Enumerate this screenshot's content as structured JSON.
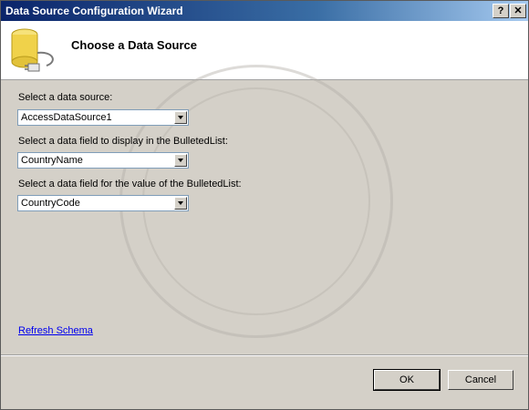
{
  "window": {
    "title": "Data Source Configuration Wizard",
    "help_label": "?",
    "close_label": "✕"
  },
  "header": {
    "title": "Choose a Data Source"
  },
  "form": {
    "data_source_label": "Select a data source:",
    "data_source_value": "AccessDataSource1",
    "display_field_label": "Select a data field to display in the BulletedList:",
    "display_field_value": "CountryName",
    "value_field_label": "Select a data field for the value of the BulletedList:",
    "value_field_value": "CountryCode"
  },
  "links": {
    "refresh_schema": "Refresh Schema"
  },
  "buttons": {
    "ok": "OK",
    "cancel": "Cancel"
  },
  "colors": {
    "titlebar_start": "#0a246a",
    "dialog_bg": "#d4d0c8",
    "link": "#0000ee"
  }
}
